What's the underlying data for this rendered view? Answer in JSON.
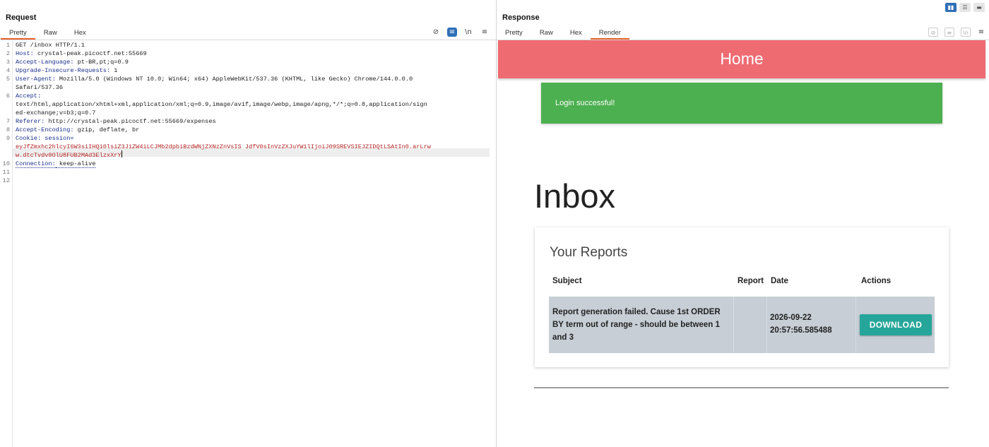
{
  "request": {
    "title": "Request",
    "tabs": [
      "Pretty",
      "Raw",
      "Hex"
    ],
    "tools": {
      "hide": "⊘",
      "wrap": "≡",
      "newline": "\\n",
      "menu": "≡"
    },
    "line_numbers": [
      "1",
      "2",
      "3",
      "4",
      "5",
      "6",
      "7",
      "8",
      "9",
      "10",
      "11",
      "12"
    ],
    "lines": {
      "l1": "GET /inbox HTTP/1.1",
      "l2_name": "Host:",
      "l2_val": " crystal-peak.picoctf.net:55669",
      "l3_name": "Accept-Language:",
      "l3_val": " pt-BR,pt;q=0.9",
      "l4_name": "Upgrade-Insecure-Requests:",
      "l4_val": " 1",
      "l5_name": "User-Agent:",
      "l5_val": " Mozilla/5.0 (Windows NT 10.0; Win64; x64) AppleWebKit/537.36 (KHTML, like Gecko) Chrome/144.0.0.0",
      "l5_cont": "Safari/537.36",
      "l6_name": "Accept:",
      "l6_cont1": "text/html,application/xhtml+xml,application/xml;q=0.9,image/avif,image/webp,image/apng,*/*;q=0.8,application/sign",
      "l6_cont2": "ed-exchange;v=b3;q=0.7",
      "l7_name": "Referer:",
      "l7_val": " http://crystal-peak.picoctf.net:55669/expenses",
      "l8_name": "Accept-Encoding:",
      "l8_val": " gzip, deflate, br",
      "l9_name": "Cookie:",
      "l9_val": " session=",
      "l9_cont1": "eyJfZmxhc2hlcyI6W3siIHQi0lsiZ3J1ZW4iLCJMb2dpbiBzdWNjZXNzZnVsIS JdfV0sInVzZXJuYW1lIjoiJ09SREVSIEJZIDQtLSAtIn0.arLrw",
      "l9_cont2": "w.dtcTvdv0OlU8FUB2MAd3ElzxXrY",
      "l10_name": "Connection:",
      "l10_val": " keep-alive"
    }
  },
  "response": {
    "title": "Response",
    "tabs": [
      "Pretty",
      "Raw",
      "Hex",
      "Render"
    ],
    "tools": {
      "hide": "⊘",
      "wrap": "≡",
      "newline": "\\n",
      "menu": "≡"
    },
    "layout_toggles": [
      "▮▮",
      "☰",
      "▬"
    ],
    "render": {
      "home_title": "Home",
      "alert": "Login successful!",
      "page_title": "Inbox",
      "card_title": "Your Reports",
      "columns": [
        "Subject",
        "Report",
        "Date",
        "Actions"
      ],
      "row": {
        "subject": "Report generation failed. Cause 1st ORDER BY term out of range - should be between 1 and 3",
        "date": "2026-09-22 20:57:56.585488",
        "action": "DOWNLOAD"
      }
    }
  },
  "colors": {
    "accent_tab": "#e8612c",
    "home_bar": "#ef6b72",
    "alert": "#4caf50",
    "download": "#26a69a",
    "row_bg": "#c7ced6"
  }
}
